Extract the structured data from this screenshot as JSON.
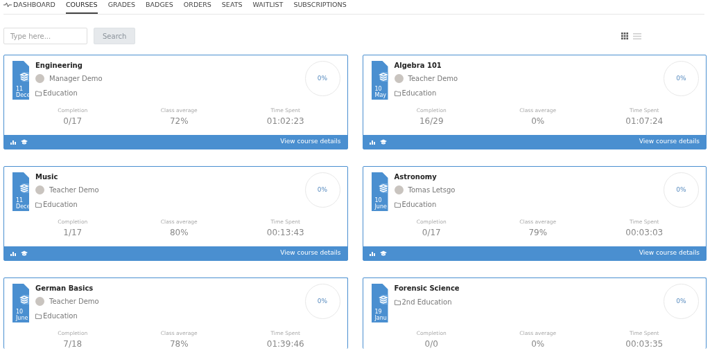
{
  "nav": [
    {
      "label": "DASHBOARD",
      "selected": false
    },
    {
      "label": "COURSES",
      "selected": true
    },
    {
      "label": "GRADES",
      "selected": false
    },
    {
      "label": "BADGES",
      "selected": false
    },
    {
      "label": "ORDERS",
      "selected": false
    },
    {
      "label": "SEATS",
      "selected": false
    },
    {
      "label": "WAITLIST",
      "selected": false
    },
    {
      "label": "SUBSCRIPTIONS",
      "selected": false
    }
  ],
  "search": {
    "placeholder": "Type here...",
    "button": "Search"
  },
  "view_toggle": [
    {
      "kind": "grid",
      "selected": true
    },
    {
      "kind": "list",
      "selected": false
    }
  ],
  "courses": [
    {
      "title": "Engineering",
      "date_day": "11",
      "date_month": "Dece",
      "instructor": "Manager Demo",
      "category": "Education",
      "progress": "0%",
      "stats": [
        {
          "label": "Completion",
          "value": "0/17"
        },
        {
          "label": "Class average",
          "value": "72%"
        },
        {
          "label": "Time Spent",
          "value": "01:02:23"
        }
      ],
      "link": "View course details"
    },
    {
      "title": "Algebra 101",
      "date_day": "10",
      "date_month": "May",
      "instructor": "Teacher Demo",
      "category": "Education",
      "progress": "0%",
      "stats": [
        {
          "label": "Completion",
          "value": "16/29"
        },
        {
          "label": "Class average",
          "value": "0%"
        },
        {
          "label": "Time Spent",
          "value": "01:07:24"
        }
      ],
      "link": "View course details"
    },
    {
      "title": "Music",
      "date_day": "11",
      "date_month": "Dece",
      "instructor": "Teacher Demo",
      "category": "Education",
      "progress": "0%",
      "stats": [
        {
          "label": "Completion",
          "value": "1/17"
        },
        {
          "label": "Class average",
          "value": "80%"
        },
        {
          "label": "Time Spent",
          "value": "00:13:43"
        }
      ],
      "link": "View course details"
    },
    {
      "title": "Astronomy",
      "date_day": "10",
      "date_month": "June",
      "instructor": "Tomas Letsgo",
      "category": "Education",
      "progress": "0%",
      "stats": [
        {
          "label": "Completion",
          "value": "0/17"
        },
        {
          "label": "Class average",
          "value": "79%"
        },
        {
          "label": "Time Spent",
          "value": "00:03:03"
        }
      ],
      "link": "View course details"
    },
    {
      "title": "German Basics",
      "date_day": "10",
      "date_month": "June",
      "instructor": "Teacher Demo",
      "category": "Education",
      "progress": "0%",
      "stats": [
        {
          "label": "Completion",
          "value": "7/18"
        },
        {
          "label": "Class average",
          "value": "78%"
        },
        {
          "label": "Time Spent",
          "value": "01:39:46"
        }
      ]
    },
    {
      "title": "Forensic Science",
      "date_day": "19",
      "date_month": "Janu",
      "category": "2nd Education",
      "progress": "0%",
      "stats": [
        {
          "label": "Completion",
          "value": "0/0"
        },
        {
          "label": "Class average",
          "value": "0%"
        },
        {
          "label": "Time Spent",
          "value": "00:03:35"
        }
      ]
    }
  ]
}
